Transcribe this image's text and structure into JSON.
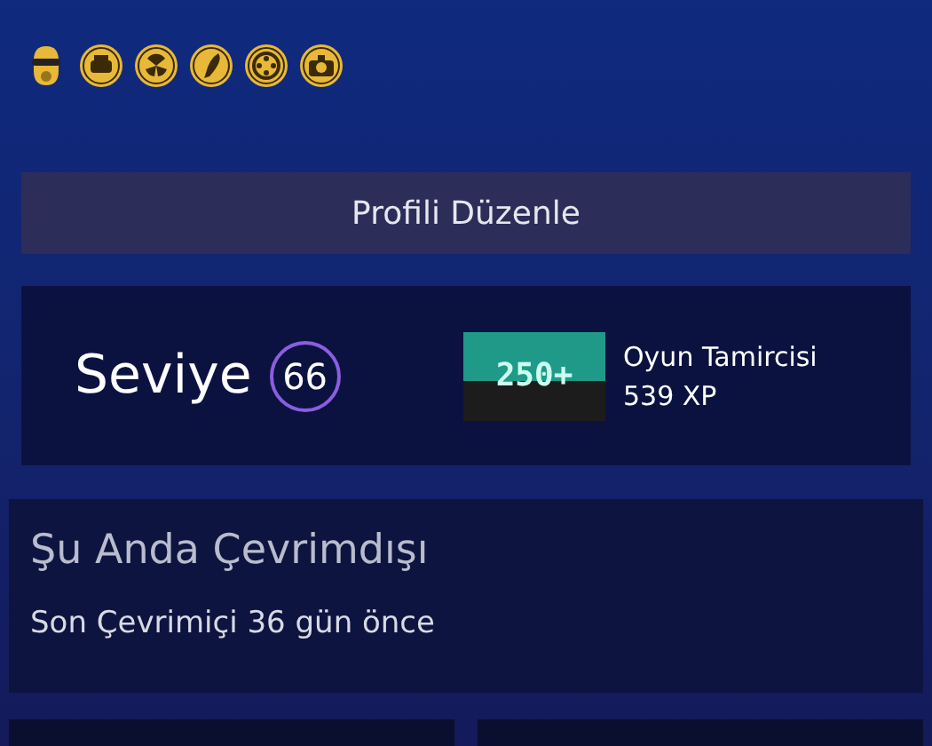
{
  "badge_icons": [
    {
      "kind": "mask"
    },
    {
      "kind": "car"
    },
    {
      "kind": "radiation"
    },
    {
      "kind": "feather"
    },
    {
      "kind": "wheel"
    },
    {
      "kind": "camera"
    }
  ],
  "edit_profile_button": "Profili Düzenle",
  "level": {
    "label": "Seviye",
    "value": "66",
    "badge": {
      "text": "250+",
      "name": "Oyun Tamircisi",
      "xp": "539 XP"
    }
  },
  "status": {
    "title": "Şu Anda Çevrimdışı",
    "last_online": "Son Çevrimiçi 36 gün önce"
  },
  "bottom_cards": [
    {
      "kind": "panel"
    },
    {
      "kind": "panel"
    }
  ]
}
